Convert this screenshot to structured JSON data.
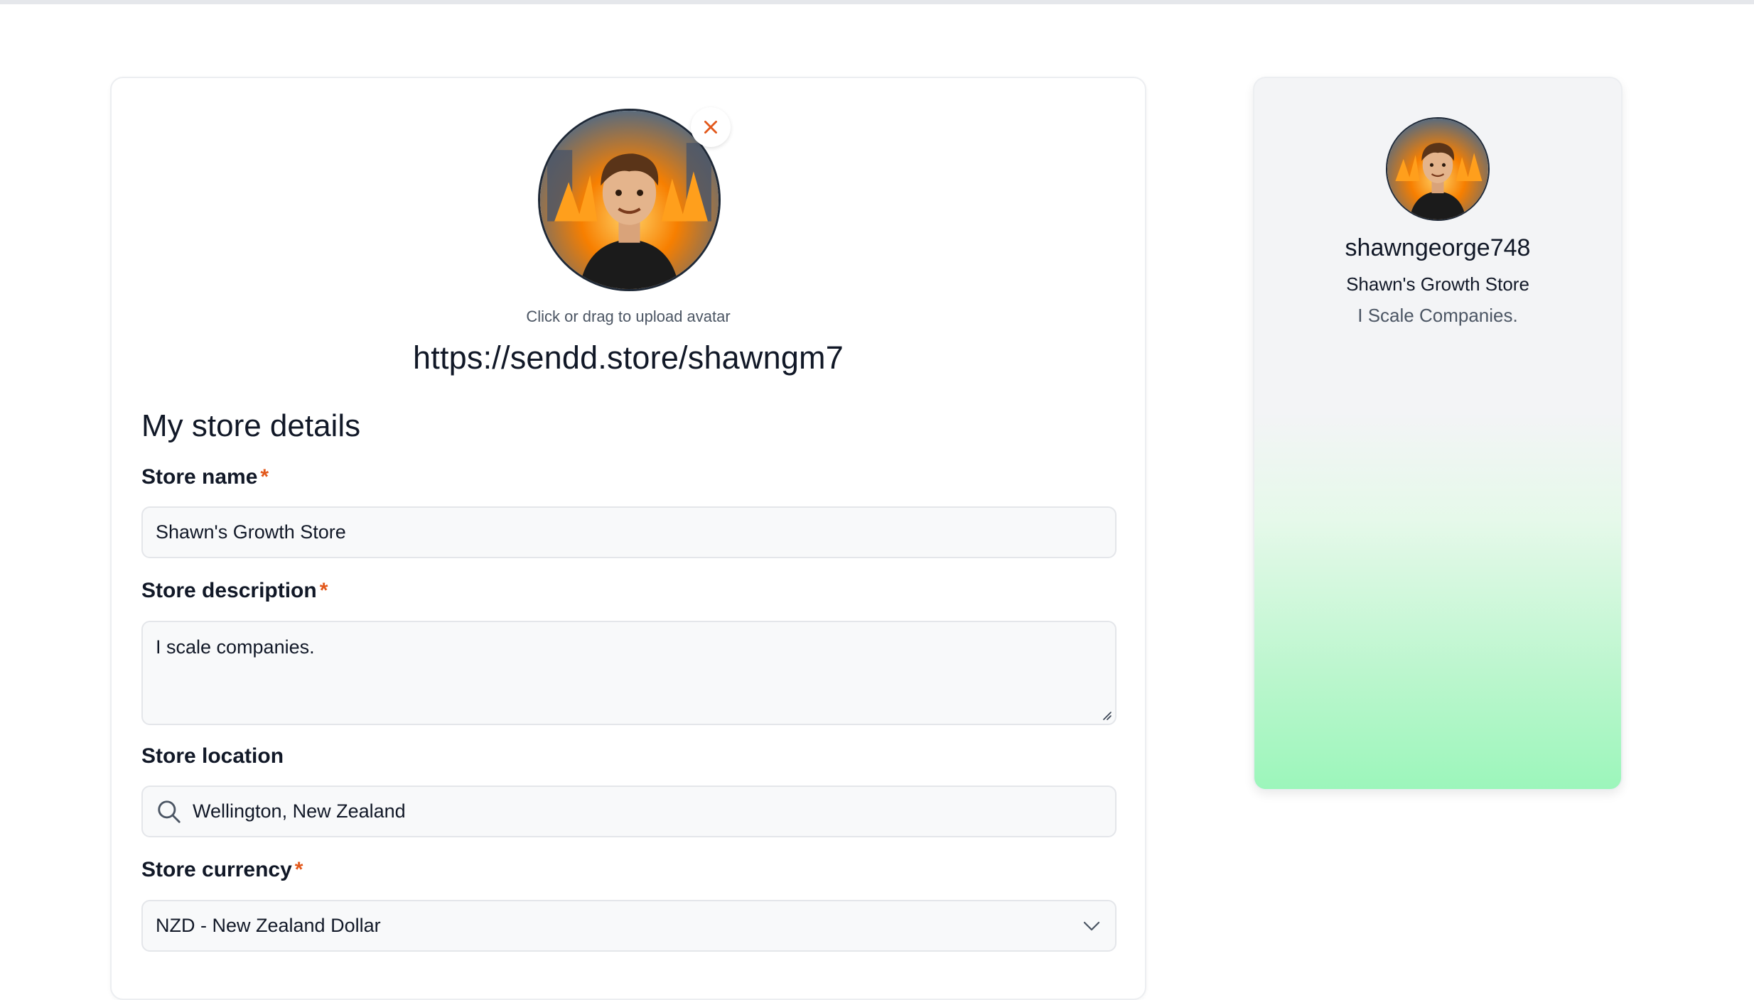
{
  "colors": {
    "accent": "#e2581b",
    "field_bg": "#f8f9fa",
    "preview_gradient_end": "#9cf6bb"
  },
  "avatar": {
    "upload_hint": "Click or drag to upload avatar",
    "remove_icon": "close-icon"
  },
  "store_url": "https://sendd.store/shawngm7",
  "form": {
    "section_title": "My store details",
    "store_name": {
      "label": "Store name",
      "required_mark": "*",
      "value": "Shawn's Growth Store"
    },
    "store_description": {
      "label": "Store description",
      "required_mark": "*",
      "value": "I scale companies."
    },
    "store_location": {
      "label": "Store location",
      "icon": "search-icon",
      "value": "Wellington, New Zealand"
    },
    "store_currency": {
      "label": "Store currency",
      "required_mark": "*",
      "value": "NZD - New Zealand Dollar",
      "icon": "chevron-down-icon"
    }
  },
  "preview": {
    "username": "shawngeorge748",
    "store_name": "Shawn's Growth Store",
    "description": "I Scale Companies."
  }
}
